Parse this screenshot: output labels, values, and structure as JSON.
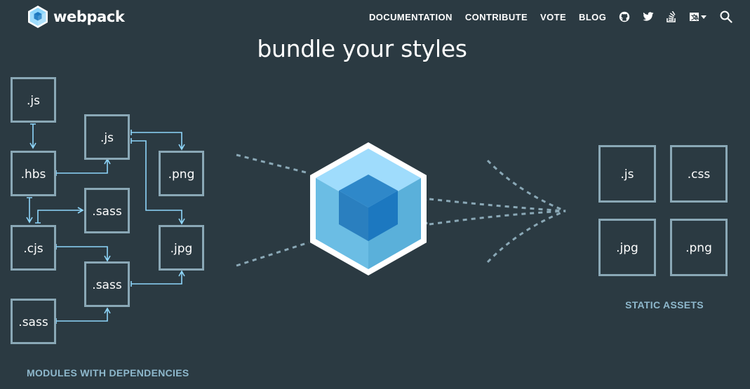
{
  "brand": {
    "name": "webpack"
  },
  "nav": {
    "links": [
      "DOCUMENTATION",
      "CONTRIBUTE",
      "VOTE",
      "BLOG"
    ],
    "icons": [
      "github-icon",
      "twitter-icon",
      "stack-overflow-icon",
      "language-icon",
      "search-icon"
    ]
  },
  "hero": {
    "title": "bundle your styles"
  },
  "modules": {
    "caption": "MODULES WITH DEPENDENCIES",
    "boxes": [
      ".js",
      ".hbs",
      ".cjs",
      ".sass",
      ".js",
      ".sass",
      ".sass",
      ".png",
      ".jpg"
    ]
  },
  "assets": {
    "caption": "STATIC ASSETS",
    "boxes": [
      ".js",
      ".css",
      ".jpg",
      ".png"
    ]
  },
  "colors": {
    "background": "#2b3a42",
    "box_border": "#8aa8b6",
    "arrow": "#8ed6fb",
    "caption": "#8eb8cc",
    "cube_light": "#8ed6fb",
    "cube_dark": "#1c78c0"
  }
}
